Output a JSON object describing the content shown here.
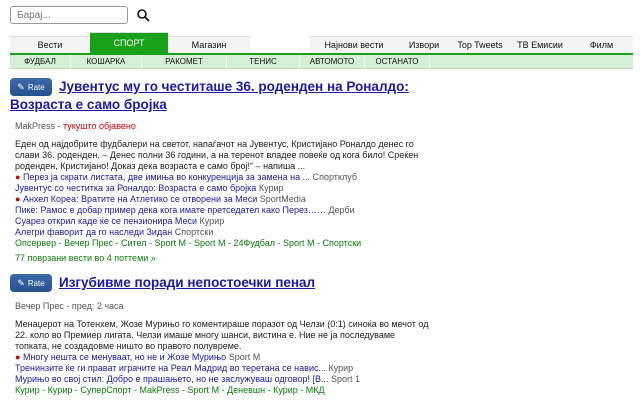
{
  "search": {
    "placeholder": "Барај..."
  },
  "nav_top": [
    {
      "label": "Вести",
      "active": false
    },
    {
      "label": "СПОРТ",
      "active": true
    },
    {
      "label": "Магазин",
      "active": false
    },
    {
      "label": "Најнови вести",
      "active": false
    },
    {
      "label": "Извори",
      "active": false
    },
    {
      "label": "Top Tweets",
      "active": false
    },
    {
      "label": "ТВ Емисии",
      "active": false
    },
    {
      "label": "Филм",
      "active": false
    }
  ],
  "nav_sub": [
    "ФУДБАЛ",
    "КОШАРКА",
    "РАКОМЕТ",
    "ТЕНИС",
    "АВТОМОТО",
    "ОСТАНАТО"
  ],
  "rate_label": "Rate",
  "articles": [
    {
      "title_line1": "Јувентус му го честиташе 36. роденден на Роналдо:",
      "title_line2": "Возраста е само бројка",
      "source": "MakPress - ",
      "time": "тукушто објавено",
      "summary": "Еден од најдобрите фудбалери на светот, напаѓачот на Јувентус, Кристијано Роналдо денес го слави 36. роденден. – Денес полни 36 години, а на теренот владее повеќе од кога било! Среќен роденден, Кристијано! Доказ дека возраста е само број!“ – напиша ...",
      "related": [
        {
          "bullet": true,
          "text": "Перез ја скрати листата, две имиња во конкуренција за замена на ...",
          "src": "Спортклуб"
        },
        {
          "bullet": false,
          "text": "Јувентус со честитка за Роналдо: Возраста е само бројка",
          "src": "Курир"
        },
        {
          "bullet": true,
          "text": "Анхел Кореа: Вратите на Атлетико се отворени за Меси",
          "src": "SportMedia"
        },
        {
          "bullet": false,
          "text": "Пике: Рамос е добар пример дека кога имате претседател како Перез……",
          "src": "Дерби"
        },
        {
          "bullet": false,
          "text": "Суарез открил каде ќе се пензионира Меси",
          "src": "Курир"
        },
        {
          "bullet": false,
          "text": "Алегри фаворит да го наследи Зидан",
          "src": "Спортски"
        }
      ],
      "green_links": "Опсервер - Вечер Прес - Сител - Sport M - Sport M - 24Фудбал - Sport M - Спортски",
      "more": "77 поврзани вести во 4 поттеми »"
    },
    {
      "title_line1": "Изгубивме поради непостоечки пенал",
      "title_line2": "",
      "source": "Вечер Прес - ",
      "time": "пред: 2 часа",
      "summary": "Менаџерот на Тотенхем, Жозе Мурињо го коментираше поразот од Челзи (0:1) синоќа во мечот од 22. коло во Премиер лигата. Челзи имаше многу шанси, вистина е. Ние не ја последуваме топката, не создадовме ништо во правото полувреме.",
      "related": [
        {
          "bullet": true,
          "text": "Многу нешта се менуваат, но не и Жозе Мурињо",
          "src": "Sport M"
        },
        {
          "bullet": false,
          "text": "Тренинзите ќе ги прават играчите на Реал Мадрид во теретана се навис...",
          "src": "Курир"
        },
        {
          "bullet": false,
          "text": "Мурињо во свој стил: Добро е прашањето, но не заслужуваш одговор! [В...",
          "src": "Sport 1"
        }
      ],
      "green_links": "Курир - Курир - СуперСпорт - MakPress - Sport M - Деневшн - Курир - МКД",
      "more": ""
    }
  ]
}
